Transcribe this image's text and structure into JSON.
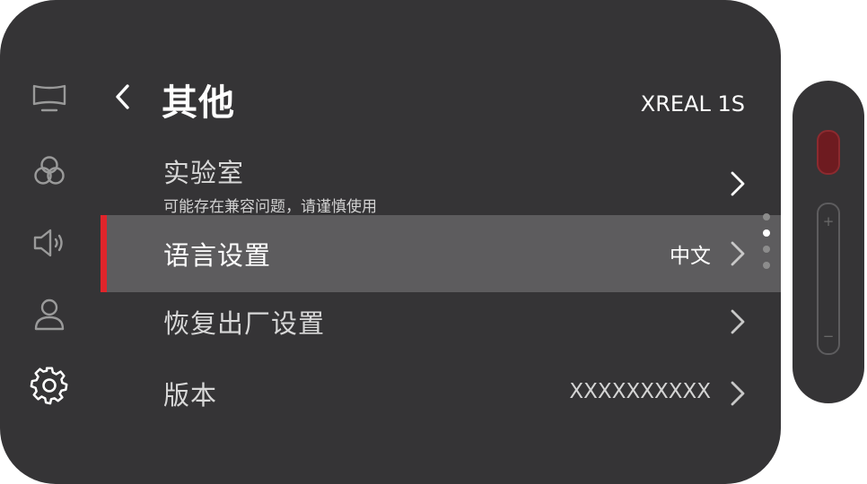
{
  "sidebar": {
    "items": [
      {
        "icon": "display-icon"
      },
      {
        "icon": "color-circles-icon"
      },
      {
        "icon": "speaker-icon"
      },
      {
        "icon": "user-icon"
      },
      {
        "icon": "gear-icon",
        "active": true
      }
    ]
  },
  "header": {
    "back_icon": "chevron-left-icon",
    "title": "其他",
    "device": "XREAL 1S"
  },
  "menu": {
    "items": [
      {
        "label": "实验室",
        "sub": "可能存在兼容问题，请谨慎使用",
        "value": ""
      },
      {
        "label": "语言设置",
        "value": "中文",
        "selected": true
      },
      {
        "label": "恢复出厂设置",
        "value": ""
      },
      {
        "label": "版本",
        "value": "XXXXXXXXXX"
      }
    ]
  },
  "colors": {
    "panel": "#353436",
    "selected_row": "#5d5c5e",
    "accent": "#e0252b"
  },
  "side_control": {
    "plus": "+",
    "minus": "−"
  }
}
